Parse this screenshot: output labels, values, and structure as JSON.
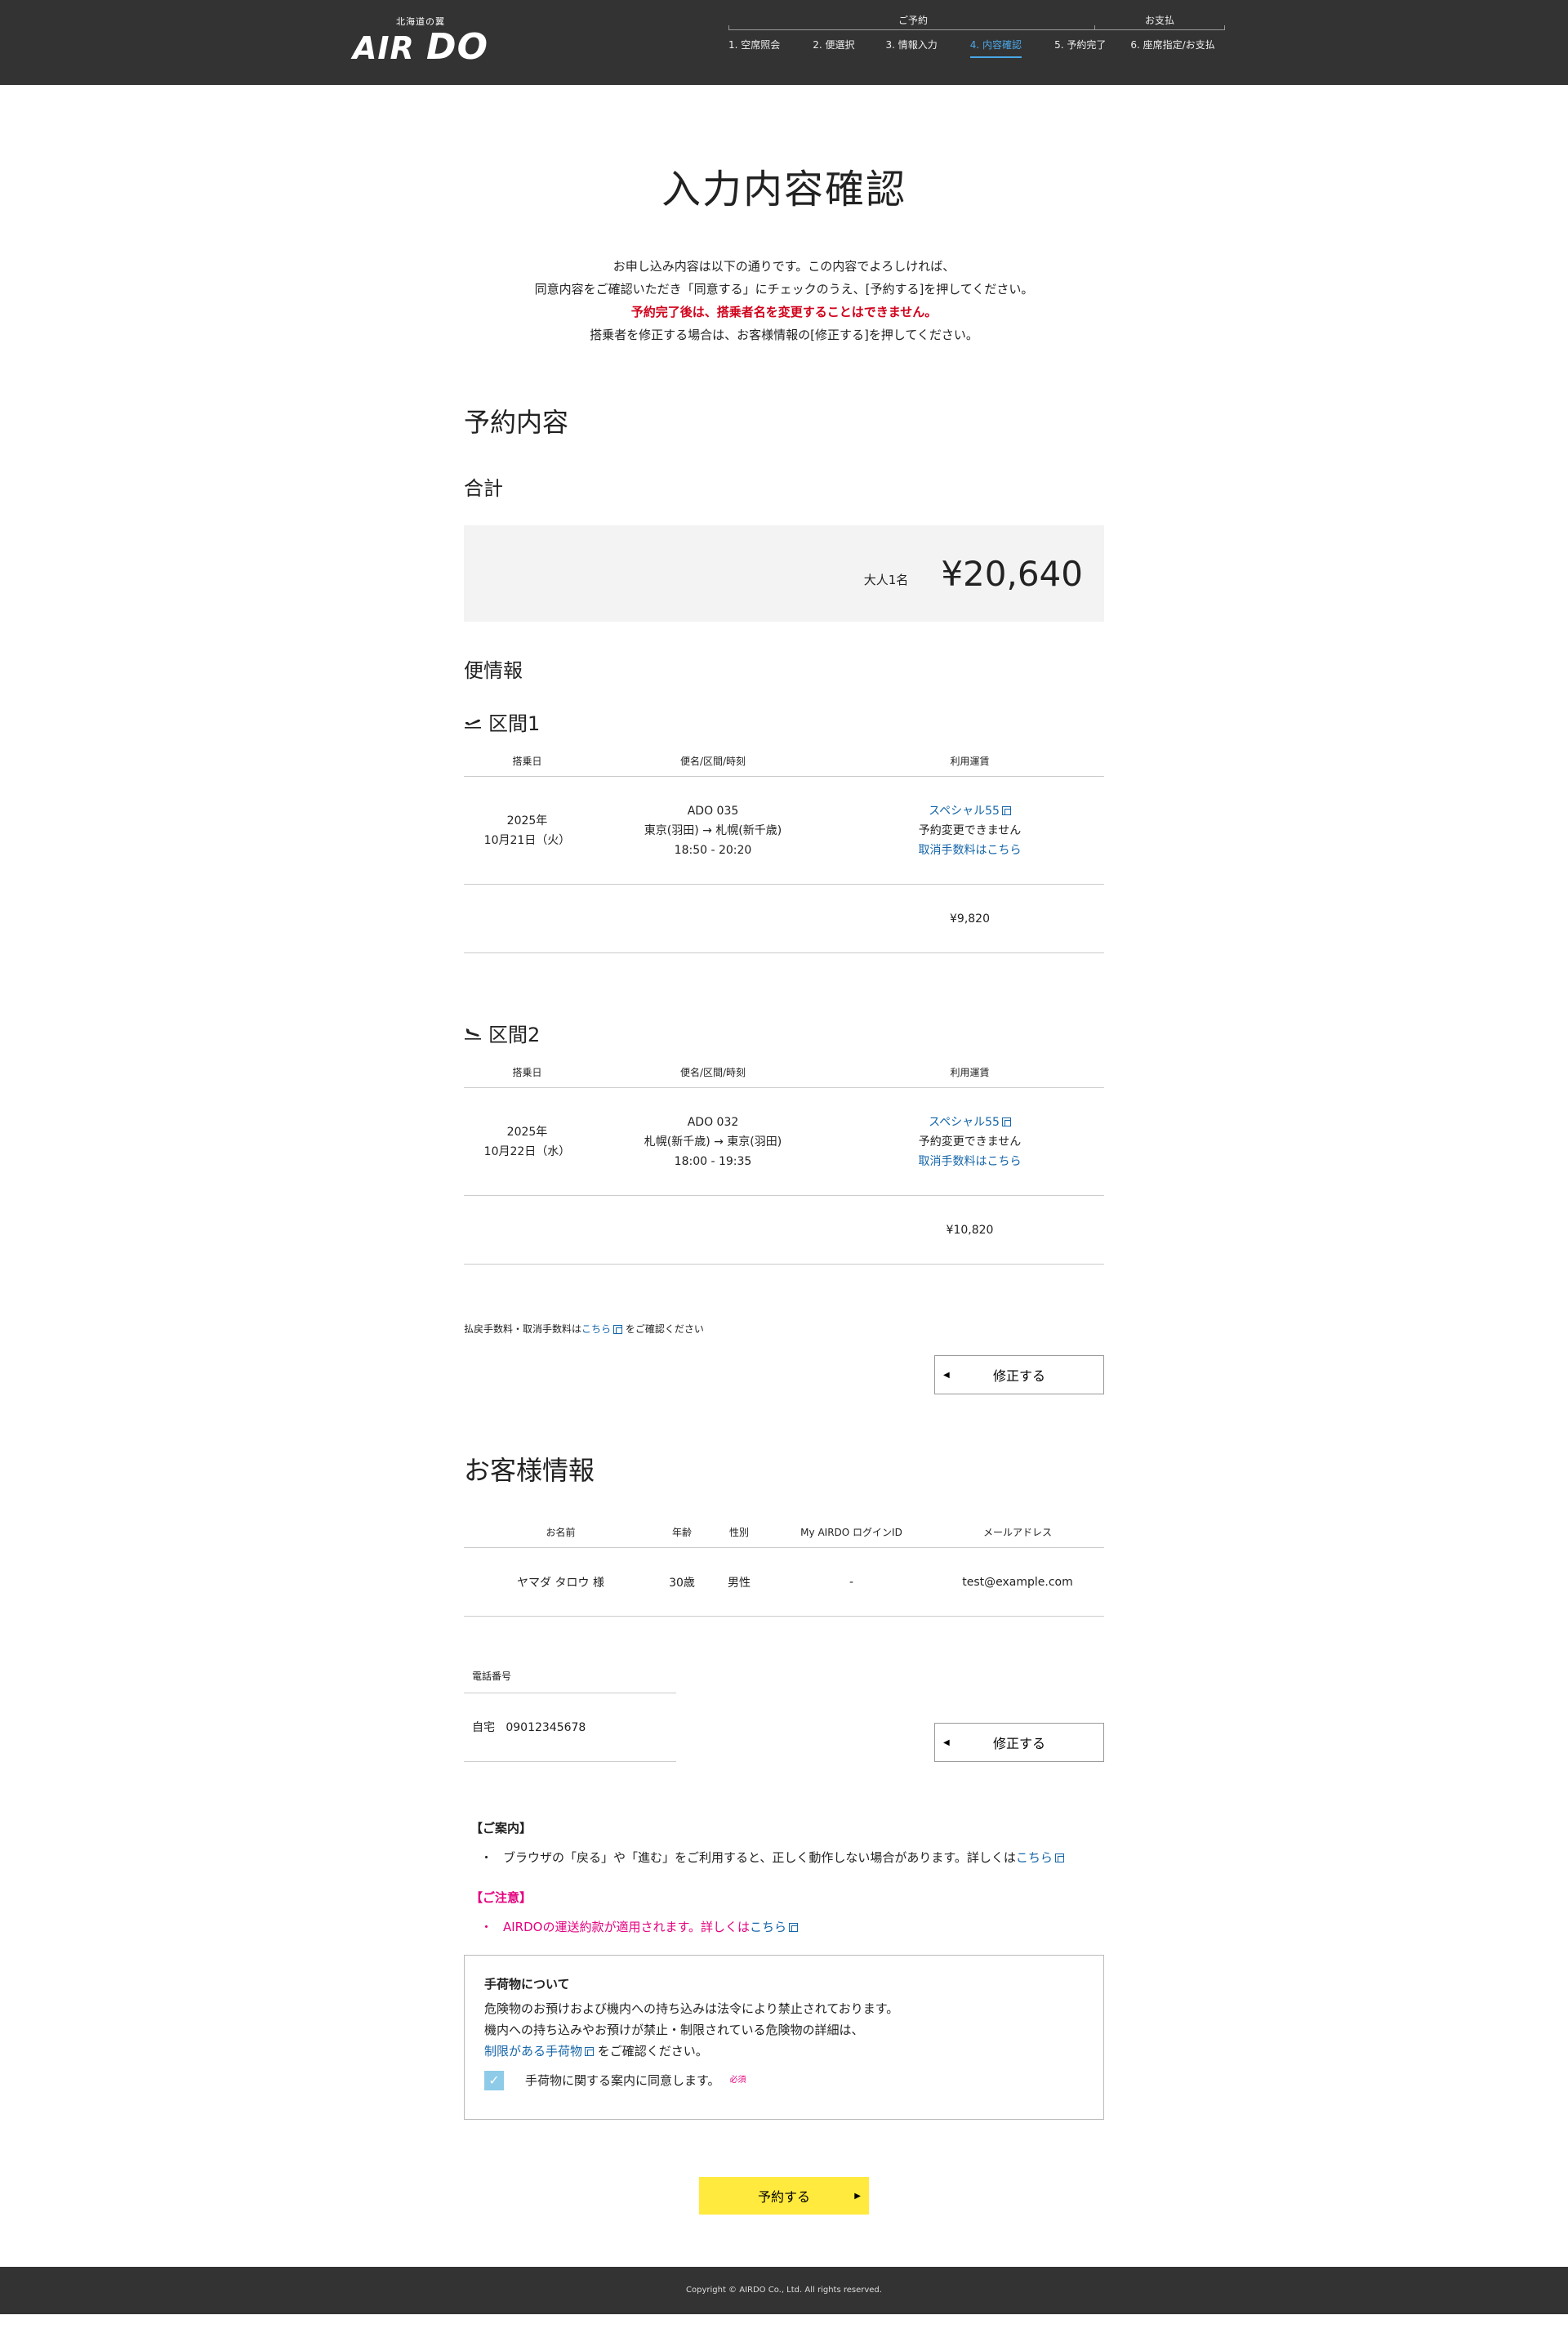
{
  "header": {
    "tagline": "北海道の翼",
    "logo_air": "AIR",
    "logo_do": "DO",
    "group_reservation": "ご予約",
    "group_payment": "お支払",
    "steps": [
      "1. 空席照会",
      "2. 便選択",
      "3. 情報入力",
      "4. 内容確認",
      "5. 予約完了",
      "6. 座席指定/お支払"
    ],
    "active_step": 4,
    "accent_color": "#4aa8e8"
  },
  "page": {
    "title": "入力内容確認",
    "intro_line1": "お申し込み内容は以下の通りです。この内容でよろしければ、",
    "intro_line2": "同意内容をご確認いただき「同意する」にチェックのうえ、[予約する]を押してください。",
    "intro_warning": "予約完了後は、搭乗者名を変更することはできません。",
    "intro_line4": "搭乗者を修正する場合は、お客様情報の[修正する]を押してください。"
  },
  "reservation": {
    "heading": "予約内容",
    "total_heading": "合計",
    "people": "大人1名",
    "total_amount": "¥20,640",
    "flight_info_heading": "便情報",
    "columns": [
      "搭乗日",
      "便名/区間/時刻",
      "利用運賃"
    ],
    "segments": [
      {
        "title": "区間1",
        "date_year": "2025年",
        "date_day": "10月21日（火）",
        "flight_no": "ADO 035",
        "route": "東京(羽田) → 札幌(新千歳)",
        "time": "18:50 - 20:20",
        "fare_name": "スペシャル55",
        "fare_note": "予約変更できません",
        "cancel_link": "取消手数料はこちら",
        "price": "¥9,820"
      },
      {
        "title": "区間2",
        "date_year": "2025年",
        "date_day": "10月22日（水）",
        "flight_no": "ADO 032",
        "route": "札幌(新千歳) → 東京(羽田)",
        "time": "18:00 - 19:35",
        "fare_name": "スペシャル55",
        "fare_note": "予約変更できません",
        "cancel_link": "取消手数料はこちら",
        "price": "¥10,820"
      }
    ],
    "fee_note_prefix": "払戻手数料・取消手数料は",
    "fee_note_link": "こちら",
    "fee_note_suffix": " をご確認ください",
    "modify_label": "修正する"
  },
  "customer": {
    "heading": "お客様情報",
    "columns": [
      "お名前",
      "年齢",
      "性別",
      "My AIRDO ログインID",
      "メールアドレス"
    ],
    "row": {
      "name": "ヤマダ タロウ 様",
      "age": "30歳",
      "gender": "男性",
      "login_id": "-",
      "email": "test@example.com"
    },
    "phone_heading": "電話番号",
    "phone_type": "自宅",
    "phone_number": "09012345678",
    "modify_label": "修正する"
  },
  "notice": {
    "title": "【ご案内】",
    "item_text": "ブラウザの「戻る」や「進む」をご利用すると、正しく動作しない場合があります。詳しくは",
    "item_link": "こちら"
  },
  "caution": {
    "title": "【ご注意】",
    "item_text": "AIRDOの運送約款が適用されます。詳しくは",
    "item_link": "こちら",
    "color": "#e4007f"
  },
  "baggage": {
    "title": "手荷物について",
    "line1": "危険物のお預けおよび機内への持ち込みは法令により禁止されております。",
    "line2": "機内への持ち込みやお預けが禁止・制限されている危険物の詳細は、",
    "link": "制限がある手荷物",
    "line3_suffix": " をご確認ください。",
    "agree_label": "手荷物に関する案内に同意します。",
    "required": "必須",
    "checked": true
  },
  "submit": {
    "label": "予約する",
    "color": "#ffea3d"
  },
  "footer": {
    "copyright": "Copyright © AIRDO Co., Ltd. All rights reserved."
  }
}
